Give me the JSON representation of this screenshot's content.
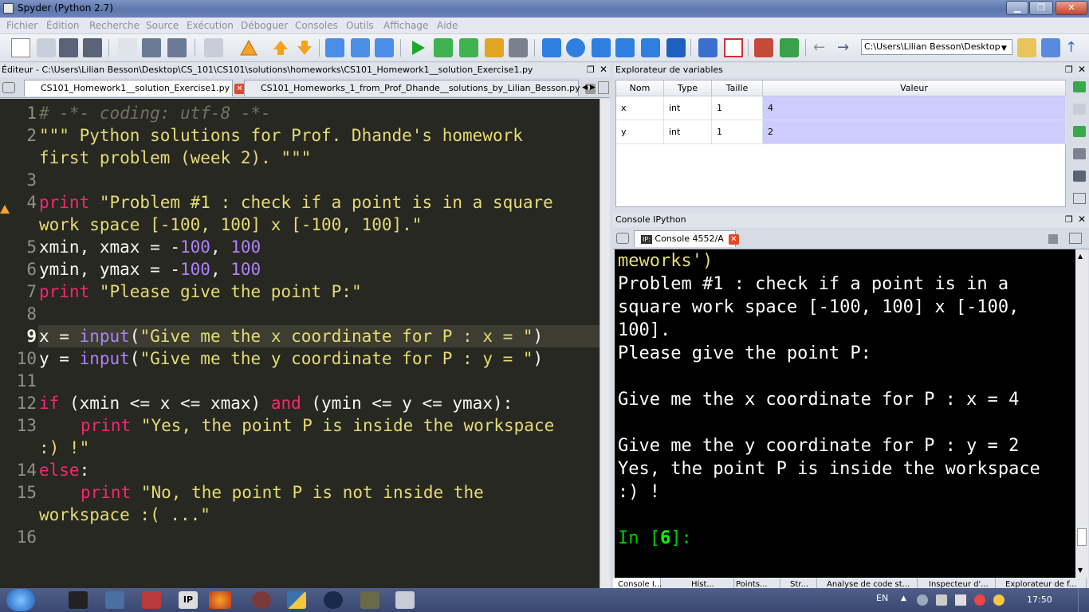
{
  "window": {
    "title": "Spyder (Python 2.7)"
  },
  "menu": [
    "Fichier",
    "Édition",
    "Recherche",
    "Source",
    "Exécution",
    "Déboguer",
    "Consoles",
    "Outils",
    "Affichage",
    "Aide"
  ],
  "toolbar": {
    "path": "C:\\Users\\Lilian Besson\\Desktop"
  },
  "editor": {
    "header": "Éditeur - C:\\Users\\Lilian Besson\\Desktop\\CS_101\\CS101\\solutions\\homeworks\\CS101_Homework1__solution_Exercise1.py",
    "tabs": [
      {
        "label": "CS101_Homework1__solution_Exercise1.py",
        "active": true
      },
      {
        "label": "CS101_Homeworks_1_from_Prof_Dhande__solutions_by_Lilian_Besson.py",
        "active": false
      }
    ],
    "current_line": 9,
    "warning_line": 4,
    "line_numbers": [
      "1",
      "2",
      "3",
      "4",
      "5",
      "6",
      "7",
      "8",
      "9",
      "10",
      "11",
      "12",
      "13",
      "14",
      "15",
      "16"
    ],
    "code": {
      "l1": "# -*- coding: utf-8 -*-",
      "l2a": "\"\"\" Python solutions for Prof. Dhande's homework",
      "l2b": "first problem (week 2). \"\"\"",
      "l4kw": "print",
      "l4a": " \"Problem #1 : check if a point is in a square",
      "l4b": "work space [-100, 100] x [-100, 100].\"",
      "l5a": "xmin, xmax = -",
      "l5n1": "100",
      "l5b": ", ",
      "l5n2": "100",
      "l6a": "ymin, ymax = -",
      "l6n1": "100",
      "l6b": ", ",
      "l6n2": "100",
      "l7kw": "print",
      "l7s": " \"Please give the point P:\"",
      "l9a": "x = ",
      "l9fn": "input",
      "l9b": "(",
      "l9s": "\"Give me the x coordinate for P : x = \"",
      "l9c": ")",
      "l10a": "y = ",
      "l10fn": "input",
      "l10b": "(",
      "l10s": "\"Give me the y coordinate for P : y = \"",
      "l10c": ")",
      "l12kw": "if",
      "l12a": " (xmin <= x <= xmax) ",
      "l12and": "and",
      "l12b": " (ymin <= y <= ymax):",
      "l13kw": "print",
      "l13s": " \"Yes, the point P is inside the workspace",
      "l13b": ":) !\"",
      "l14kw": "else",
      "l14a": ":",
      "l15kw": "print",
      "l15s": " \"No, the point P is not inside the",
      "l15b": "workspace :( ...\""
    }
  },
  "variable_explorer": {
    "title": "Explorateur de variables",
    "columns": [
      "Nom",
      "Type",
      "Taille",
      "Valeur"
    ],
    "rows": [
      {
        "name": "x",
        "type": "int",
        "size": "1",
        "value": "4"
      },
      {
        "name": "y",
        "type": "int",
        "size": "1",
        "value": "2"
      }
    ]
  },
  "console": {
    "title": "Console IPython",
    "tab": "Console 4552/A",
    "lines": [
      "meworks')",
      "Problem #1 : check if a point is in a",
      "square work space [-100, 100] x [-100,",
      "100].",
      "Please give the point P:",
      "",
      "Give me the x coordinate for P : x = 4",
      "",
      "Give me the y coordinate for P : y = 2",
      "Yes, the point P is inside the workspace",
      ":) !",
      ""
    ],
    "prompt_in": "In [",
    "prompt_num": "6",
    "prompt_end": "]:",
    "bottom_tabs": [
      "Console I...",
      "Hist...",
      "Points...",
      "Str...",
      "Analyse de code st...",
      "Inspecteur d'...",
      "Explorateur de f..."
    ]
  },
  "taskbar": {
    "clock": "17:50",
    "lang": "EN"
  },
  "colors": {
    "editor_bg": "#272822",
    "keyword": "#f92672",
    "builtin": "#ae81ff",
    "string": "#e6db74",
    "comment": "#75715e",
    "prompt": "#00cc00",
    "var_value_bg": "#ccccff"
  }
}
